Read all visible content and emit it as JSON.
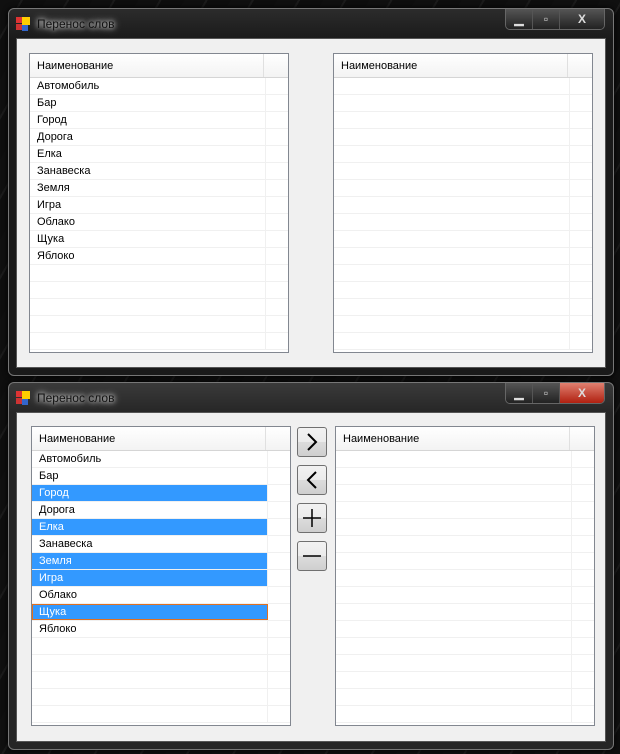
{
  "windows": [
    {
      "title": "Перенос слов",
      "left_header": "Наименование",
      "right_header": "Наименование",
      "left_items": [
        {
          "label": "Автомобиль",
          "selected": false
        },
        {
          "label": "Бар",
          "selected": false
        },
        {
          "label": "Город",
          "selected": false
        },
        {
          "label": "Дорога",
          "selected": false
        },
        {
          "label": "Елка",
          "selected": false
        },
        {
          "label": "Занавеска",
          "selected": false
        },
        {
          "label": "Земля",
          "selected": false
        },
        {
          "label": "Игра",
          "selected": false
        },
        {
          "label": "Облако",
          "selected": false
        },
        {
          "label": "Щука",
          "selected": false
        },
        {
          "label": "Яблоко",
          "selected": false
        }
      ],
      "right_items": []
    },
    {
      "title": "Перенос слов",
      "left_header": "Наименование",
      "right_header": "Наименование",
      "buttons": {
        "move_right": ">",
        "move_left": "<",
        "add": "+",
        "remove": "−"
      },
      "left_items": [
        {
          "label": "Автомобиль",
          "selected": false
        },
        {
          "label": "Бар",
          "selected": false
        },
        {
          "label": "Город",
          "selected": true
        },
        {
          "label": "Дорога",
          "selected": false
        },
        {
          "label": "Елка",
          "selected": true
        },
        {
          "label": "Занавеска",
          "selected": false
        },
        {
          "label": "Земля",
          "selected": true
        },
        {
          "label": "Игра",
          "selected": true
        },
        {
          "label": "Облако",
          "selected": false
        },
        {
          "label": "Щука",
          "selected": true,
          "focused": true
        },
        {
          "label": "Яблоко",
          "selected": false
        }
      ],
      "right_items": []
    }
  ],
  "colors": {
    "selection": "#3399ff",
    "focus": "#e07020"
  }
}
